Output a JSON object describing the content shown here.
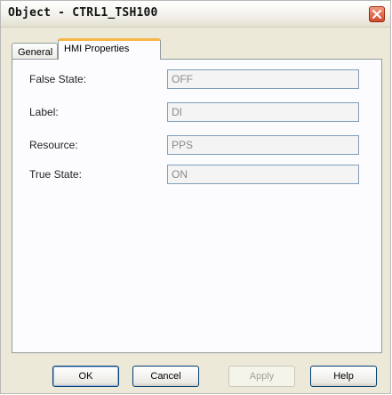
{
  "window": {
    "title": "Object - CTRL1_TSH100"
  },
  "tabs": [
    {
      "label": "General",
      "active": false
    },
    {
      "label": "HMI Properties",
      "active": true
    }
  ],
  "properties": [
    {
      "label": "False State:",
      "value": "OFF"
    },
    {
      "label": "Label:",
      "value": "DI"
    },
    {
      "label": "Resource:",
      "value": "PPS"
    },
    {
      "label": "True State:",
      "value": "ON"
    }
  ],
  "buttons": {
    "ok": "OK",
    "cancel": "Cancel",
    "apply": "Apply",
    "help": "Help"
  },
  "colors": {
    "active_tab_accent": "#f7b546",
    "close_button": "#d4492a",
    "button_border": "#003c74"
  }
}
